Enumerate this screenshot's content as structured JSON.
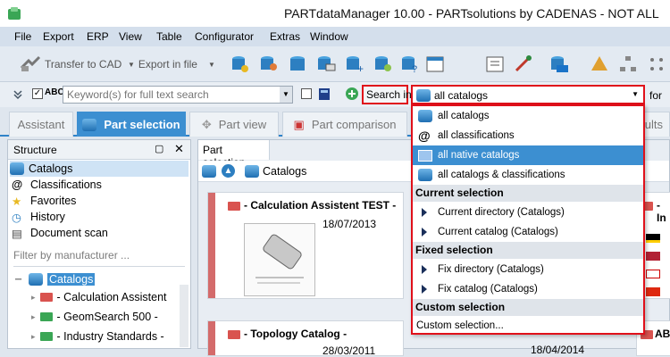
{
  "window": {
    "title": "PARTdataManager 10.00 - PARTsolutions by CADENAS - NOT ALL"
  },
  "menu": [
    "File",
    "Export",
    "ERP",
    "View",
    "Table",
    "Configurator",
    "Extras",
    "Window"
  ],
  "toolbar": {
    "transfer_label": "Transfer to CAD",
    "export_label": "Export in file"
  },
  "search": {
    "abc_label": "ABC",
    "keyword_placeholder": "Keyword(s) for full text search",
    "search_in_label": "Search in",
    "scope_value": "all catalogs",
    "for_label": "for"
  },
  "tabs": [
    "Assistant",
    "Part selection",
    "Part view",
    "Part comparison",
    "esults"
  ],
  "structure": {
    "title": "Structure",
    "items": [
      "Catalogs",
      "Classifications",
      "Favorites",
      "History",
      "Document scan"
    ],
    "filter_placeholder": "Filter by manufacturer ...",
    "tree_root": "Catalogs",
    "tree_children": [
      "- Calculation Assistent",
      "- GeomSearch 500 -",
      "- Industry Standards -"
    ]
  },
  "part_selection": {
    "title": "Part selection",
    "breadcrumb": "Catalogs",
    "cards": [
      {
        "title": "- Calculation Assistent TEST -",
        "date": "18/07/2013"
      },
      {
        "title": "- Topology Catalog -",
        "date": "28/03/2011"
      }
    ],
    "right_partial_title": "- In",
    "right_partial_title2": "ABE",
    "right_partial_date": "18/04/2014"
  },
  "dropdown": {
    "top_items": [
      "all catalogs",
      "all classifications",
      "all native catalogs",
      "all catalogs & classifications"
    ],
    "highlighted": "all native catalogs",
    "sections": [
      {
        "title": "Current selection",
        "items": [
          "Current directory (Catalogs)",
          "Current catalog (Catalogs)"
        ]
      },
      {
        "title": "Fixed selection",
        "items": [
          "Fix directory (Catalogs)",
          "Fix catalog (Catalogs)"
        ]
      },
      {
        "title": "Custom selection",
        "items": [
          "Custom selection..."
        ]
      }
    ]
  },
  "colors": {
    "accent": "#3c8fd1",
    "highlight_border": "#e0101a",
    "catalog_red": "#d46b6b"
  }
}
